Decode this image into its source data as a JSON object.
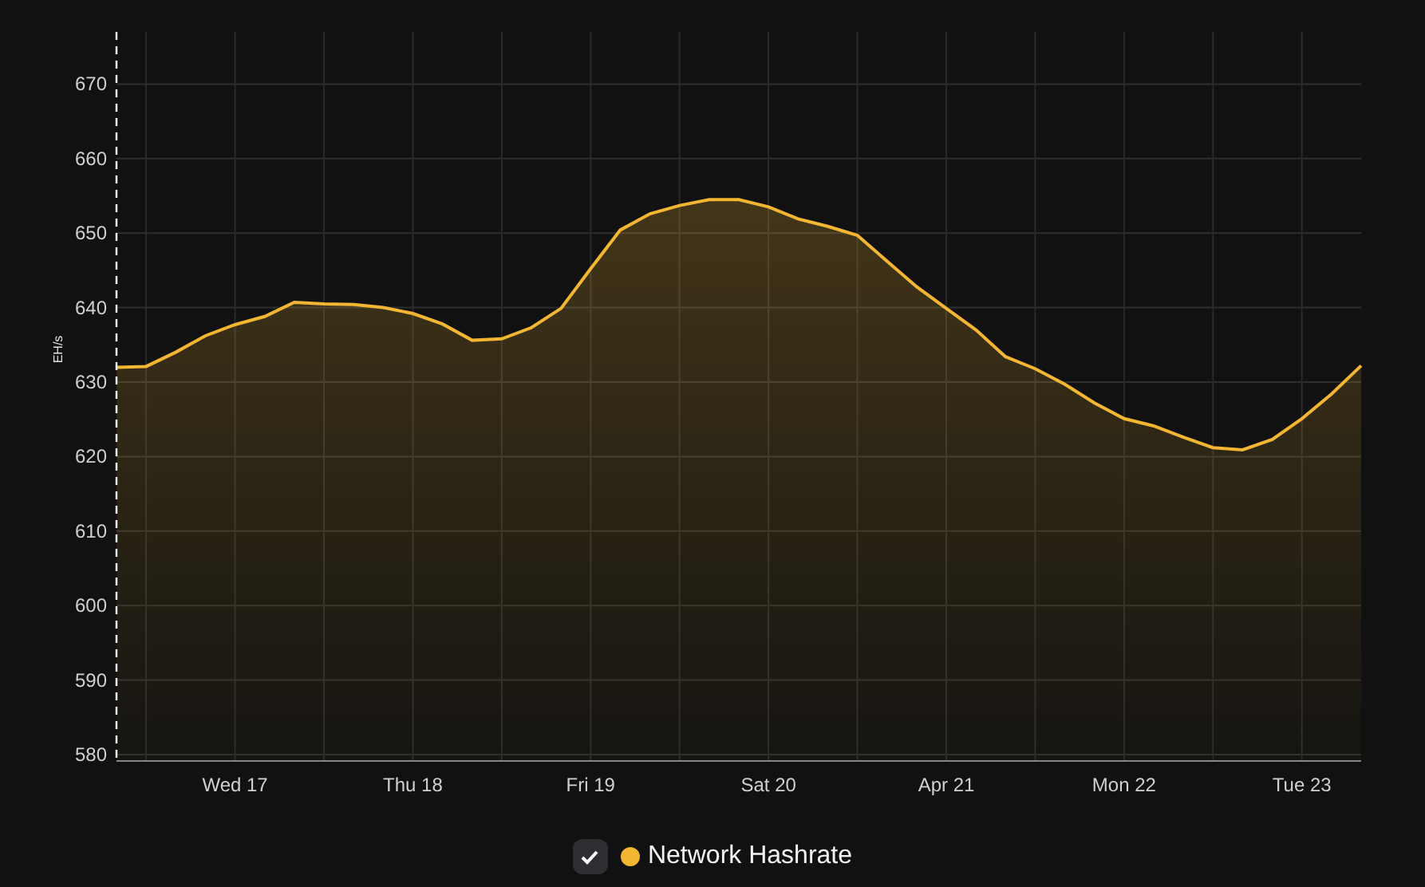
{
  "chart_data": {
    "type": "area",
    "ylabel": "EH/s",
    "categories": [
      null,
      null,
      null,
      null,
      "Wed 17",
      null,
      null,
      null,
      null,
      null,
      "Thu 18",
      null,
      null,
      null,
      null,
      null,
      "Fri 19",
      null,
      null,
      null,
      null,
      null,
      "Sat 20",
      null,
      null,
      null,
      null,
      null,
      "Apr 21",
      null,
      null,
      null,
      null,
      null,
      "Mon 22",
      null,
      null,
      null,
      null,
      null,
      "Tue 23",
      null,
      null
    ],
    "series": [
      {
        "name": "Network Hashrate",
        "color": "#f2b632",
        "values": [
          632,
          632.1,
          634,
          636.2,
          637.7,
          638.8,
          640.7,
          640.5,
          640.4,
          640,
          639.2,
          637.8,
          635.6,
          635.8,
          637.3,
          639.9,
          645.2,
          650.4,
          652.6,
          653.7,
          654.5,
          654.5,
          653.5,
          651.9,
          650.9,
          649.7,
          646.2,
          642.8,
          639.9,
          637,
          633.4,
          631.8,
          629.7,
          627.2,
          625.1,
          624.1,
          622.6,
          621.2,
          620.9,
          622.3,
          625.1,
          628.4,
          632.2
        ]
      }
    ],
    "ylim": [
      580,
      677
    ],
    "grid": true,
    "yticks": [
      580,
      590,
      600,
      610,
      620,
      630,
      640,
      650,
      660,
      670
    ]
  },
  "legend": [
    {
      "checked": true
    }
  ]
}
